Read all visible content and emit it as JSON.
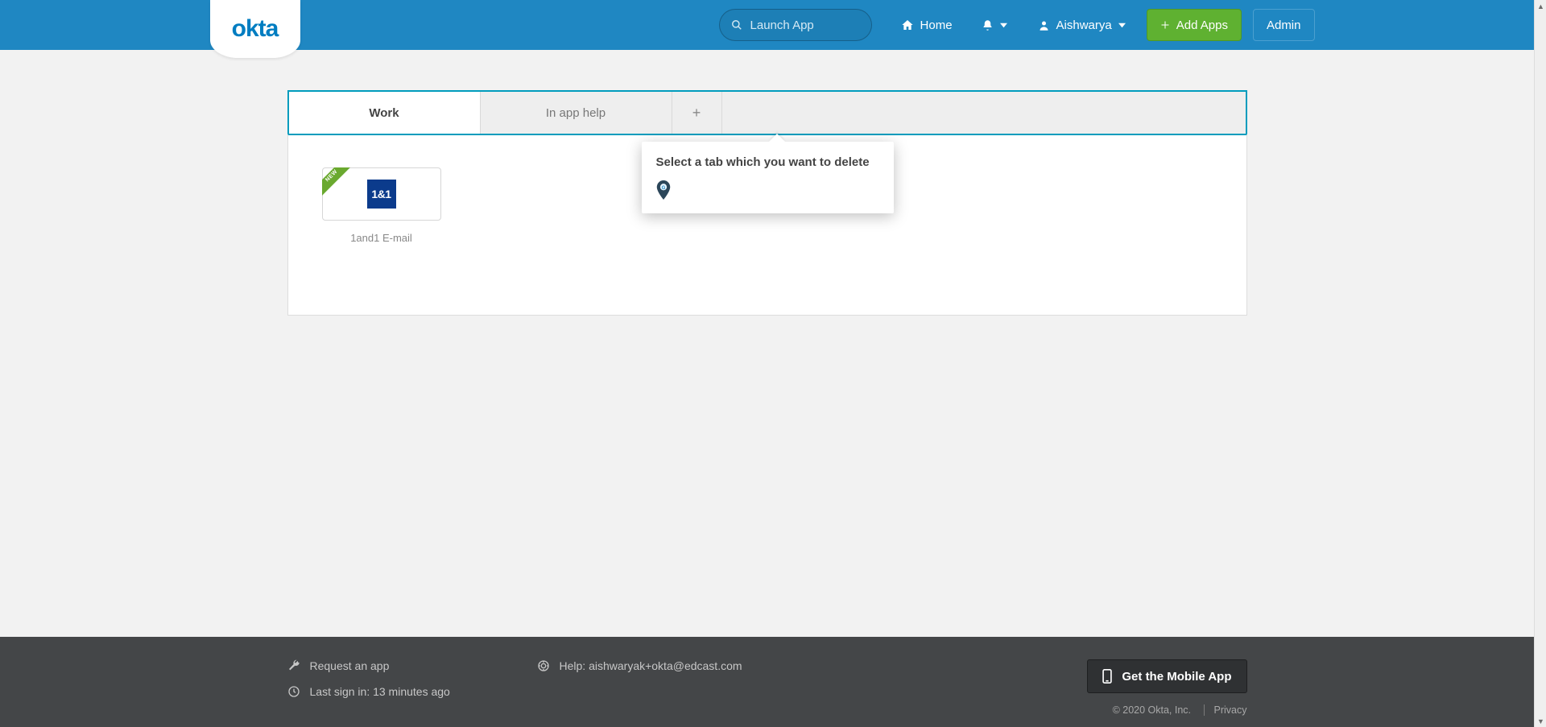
{
  "brand": {
    "name": "okta"
  },
  "header": {
    "search_placeholder": "Launch App",
    "home_label": "Home",
    "user_name": "Aishwarya",
    "add_apps_label": "Add Apps",
    "admin_label": "Admin"
  },
  "tabs": {
    "work": "Work",
    "help": "In app help",
    "add": "+"
  },
  "apps": [
    {
      "ribbon": "NEW",
      "brand_text": "1&1",
      "caption": "1and1 E-mail"
    }
  ],
  "tooltip": {
    "text": "Select a tab which you want to delete"
  },
  "footer": {
    "request_app": "Request an app",
    "help_text": "Help: aishwaryak+okta@edcast.com",
    "last_signin": "Last sign in: 13 minutes ago",
    "mobile_btn": "Get the Mobile App",
    "copyright": "© 2020 Okta, Inc.",
    "privacy": "Privacy"
  }
}
